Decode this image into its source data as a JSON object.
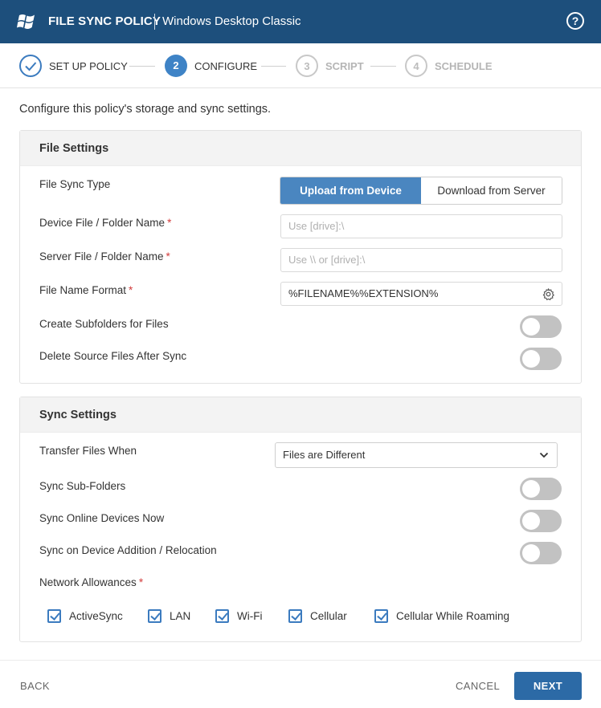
{
  "header": {
    "title": "FILE SYNC POLICY",
    "subtitle": "Windows Desktop Classic",
    "help_icon": "question-circle-icon",
    "help_label": "?"
  },
  "stepper": {
    "steps": [
      {
        "number": "",
        "label": "SET UP POLICY",
        "state": "done"
      },
      {
        "number": "2",
        "label": "CONFIGURE",
        "state": "active"
      },
      {
        "number": "3",
        "label": "SCRIPT",
        "state": "todo"
      },
      {
        "number": "4",
        "label": "SCHEDULE",
        "state": "todo"
      }
    ]
  },
  "intro": "Configure this policy's storage and sync settings.",
  "file_settings": {
    "title": "File Settings",
    "sync_type_label": "File Sync Type",
    "sync_type_options": [
      "Upload from Device",
      "Download from Server"
    ],
    "sync_type_selected": "Upload from Device",
    "device_label": "Device File / Folder Name",
    "device_placeholder": "Use [drive]:\\",
    "server_label": "Server File / Folder Name",
    "server_placeholder": "Use \\\\ or [drive]:\\",
    "format_label": "File Name Format",
    "format_value": "%FILENAME%%EXTENSION%",
    "subfolders_label": "Create Subfolders for Files",
    "subfolders_on": false,
    "delete_label": "Delete Source Files After Sync",
    "delete_on": false,
    "required_mark": "*"
  },
  "sync_settings": {
    "title": "Sync Settings",
    "transfer_label": "Transfer Files When",
    "transfer_value": "Files are Different",
    "subfolders_label": "Sync Sub-Folders",
    "subfolders_on": false,
    "online_label": "Sync Online Devices Now",
    "online_on": false,
    "addition_label": "Sync on Device Addition / Relocation",
    "addition_on": false,
    "network_label": "Network Allowances",
    "required_mark": "*",
    "networks": [
      {
        "label": "ActiveSync",
        "checked": true
      },
      {
        "label": "LAN",
        "checked": true
      },
      {
        "label": "Wi-Fi",
        "checked": true
      },
      {
        "label": "Cellular",
        "checked": true
      },
      {
        "label": "Cellular While Roaming",
        "checked": true
      }
    ]
  },
  "footer": {
    "back": "BACK",
    "cancel": "CANCEL",
    "next": "NEXT"
  },
  "colors": {
    "header_bg": "#1d4f7c",
    "accent": "#3e83c6",
    "primary_button": "#2c6aa6",
    "toggle_off": "#c2c2c2"
  }
}
